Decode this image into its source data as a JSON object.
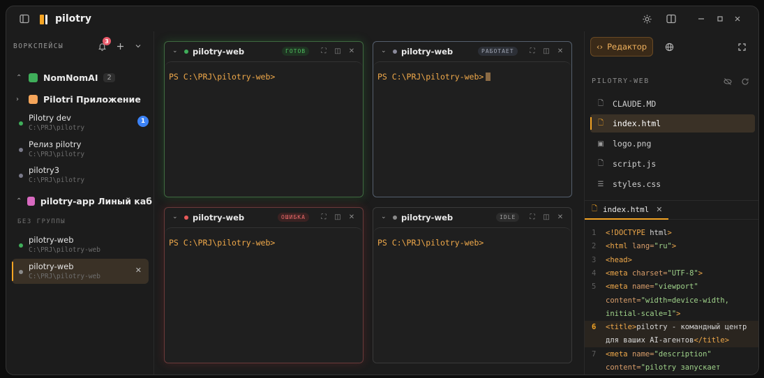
{
  "app": {
    "title": "pilotry"
  },
  "sidebar": {
    "header": "ВОРКСПЕЙСЫ",
    "notifications_count": "3",
    "groups": [
      {
        "label": "NomNomAI",
        "count": "2",
        "color": "#3fae5a",
        "expanded": true
      },
      {
        "label": "Pilotri Приложение",
        "color": "#f5a55a",
        "expanded": false
      },
      {
        "label": "pilotry-app Линый кабинет",
        "color": "#d86ac0",
        "expanded": true
      }
    ],
    "workspaces": [
      {
        "name": "Pilotry dev",
        "path": "C:\\PRJ\\pilotry",
        "status_color": "#3fae5a",
        "badge": "1"
      },
      {
        "name": "Релиз pilotry",
        "path": "C:\\PRJ\\pilotry",
        "status_color": "#7a7a8a"
      },
      {
        "name": "pilotry3",
        "path": "C:\\PRJ\\pilotry",
        "status_color": "#7a7a8a"
      }
    ],
    "no_group_label": "БЕЗ ГРУППЫ",
    "ungrouped": [
      {
        "name": "pilotry-web",
        "path": "C:\\PRJ\\pilotry-web",
        "status_color": "#3fae5a"
      },
      {
        "name": "pilotry-web",
        "path": "C:\\PRJ\\pilotry-web",
        "status_color": "#8a8a8a",
        "active": true
      }
    ]
  },
  "terminals": [
    {
      "name": "pilotry-web",
      "status": "ГОТОВ",
      "status_fg": "#4fbf5f",
      "status_bg": "#1f3322",
      "dot": "#3fae5a",
      "prompt": "PS C:\\PRJ\\pilotry-web>",
      "cursor": false
    },
    {
      "name": "pilotry-web",
      "status": "РАБОТАЕТ",
      "status_fg": "#a0a6b4",
      "status_bg": "#2c2f36",
      "dot": "#8a8a9a",
      "prompt": "PS C:\\PRJ\\pilotry-web>",
      "cursor": true
    },
    {
      "name": "pilotry-web",
      "status": "ОШИБКА",
      "status_fg": "#ef6a6a",
      "status_bg": "#3a2222",
      "dot": "#e85a5a",
      "prompt": "PS C:\\PRJ\\pilotry-web>",
      "cursor": false
    },
    {
      "name": "pilotry-web",
      "status": "IDLE",
      "status_fg": "#a0a0a0",
      "status_bg": "#2c2c2c",
      "dot": "#8a8a8a",
      "prompt": "PS C:\\PRJ\\pilotry-web>",
      "cursor": false
    }
  ],
  "right_panel": {
    "editor_label": "Редактор",
    "project_label": "PILOTRY-WEB",
    "files": [
      {
        "name": "CLAUDE.MD",
        "icon": "file-icon"
      },
      {
        "name": "index.html",
        "icon": "file-icon",
        "active": true
      },
      {
        "name": "logo.png",
        "icon": "image-icon"
      },
      {
        "name": "script.js",
        "icon": "file-icon"
      },
      {
        "name": "styles.css",
        "icon": "file-text-icon"
      }
    ],
    "open_tab": "index.html",
    "code_lines": [
      {
        "n": "1",
        "html": "<span class='kw'>&lt;!DOCTYPE</span> html<span class='kw'>&gt;</span>"
      },
      {
        "n": "2",
        "html": "<span class='kw'>&lt;html</span> <span class='at'>lang=</span><span class='str'>\"ru\"</span><span class='kw'>&gt;</span>"
      },
      {
        "n": "3",
        "html": "<span class='kw'>&lt;head&gt;</span>"
      },
      {
        "n": "4",
        "html": "<span class='kw'>&lt;meta</span> <span class='at'>charset=</span><span class='str'>\"UTF-8\"</span><span class='kw'>&gt;</span>"
      },
      {
        "n": "5",
        "html": "<span class='kw'>&lt;meta</span> <span class='at'>name=</span><span class='str'>\"viewport\"</span>"
      },
      {
        "n": "",
        "html": "<span class='at'>content=</span><span class='str'>\"width=device-width,</span>"
      },
      {
        "n": "",
        "html": "<span class='str'>initial-scale=1\"</span><span class='kw'>&gt;</span>"
      },
      {
        "n": "6",
        "hl": true,
        "html": "<span class='kw'>&lt;title&gt;</span>pilotry - командный центр"
      },
      {
        "n": "",
        "hl": true,
        "html": "для ваших AI-агентов<span class='kw'>&lt;/title&gt;</span>"
      },
      {
        "n": "7",
        "html": "<span class='kw'>&lt;meta</span> <span class='at'>name=</span><span class='str'>\"description\"</span>"
      },
      {
        "n": "",
        "html": "<span class='at'>content=</span><span class='str'>\"pilotry запускает</span>"
      }
    ]
  }
}
